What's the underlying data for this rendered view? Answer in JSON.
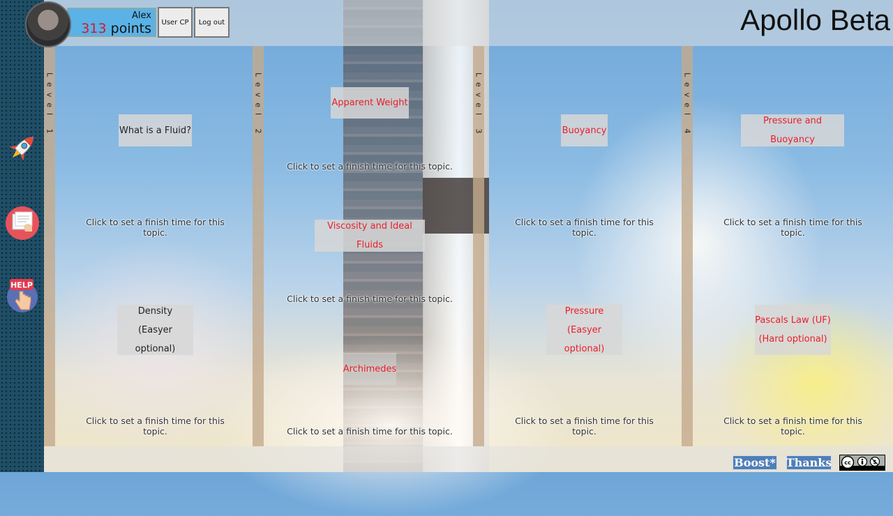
{
  "app_title": "Apollo Beta",
  "user": {
    "name": "Alex",
    "points_value": "313",
    "points_label": "points"
  },
  "header_buttons": {
    "user_cp": "User CP",
    "log_out": "Log out"
  },
  "sidebar_icons": [
    "rocket-icon",
    "document-icon",
    "help-icon"
  ],
  "help_badge": "HELP",
  "levels": [
    {
      "label": "Level 1",
      "topics": [
        {
          "title": "What is a Fluid?",
          "subtitle": ""
        },
        {
          "title": "Density",
          "subtitle": "(Easyer optional)"
        }
      ]
    },
    {
      "label": "Level 2",
      "topics": [
        {
          "title": "Apparent Weight",
          "subtitle": ""
        },
        {
          "title": "Viscosity and Ideal Fluids",
          "subtitle": ""
        },
        {
          "title": "Archimedes",
          "subtitle": ""
        }
      ]
    },
    {
      "label": "Level 3",
      "topics": [
        {
          "title": "Buoyancy",
          "subtitle": ""
        },
        {
          "title": "Pressure",
          "subtitle": "(Easyer optional)"
        }
      ]
    },
    {
      "label": "Level 4",
      "topics": [
        {
          "title": "Pressure and Buoyancy",
          "subtitle": ""
        },
        {
          "title": "Pascals Law (UF)",
          "subtitle": "(Hard optional)"
        }
      ]
    }
  ],
  "finish_text": "Click to set a finish time for this topic.",
  "footer": {
    "boost": "Boost*",
    "thanks": "Thanks",
    "license": "cc by nc"
  },
  "colors": {
    "accent_red": "#e8202b",
    "user_box": "#5ab2e6",
    "footer_button": "#4f7fb8"
  }
}
